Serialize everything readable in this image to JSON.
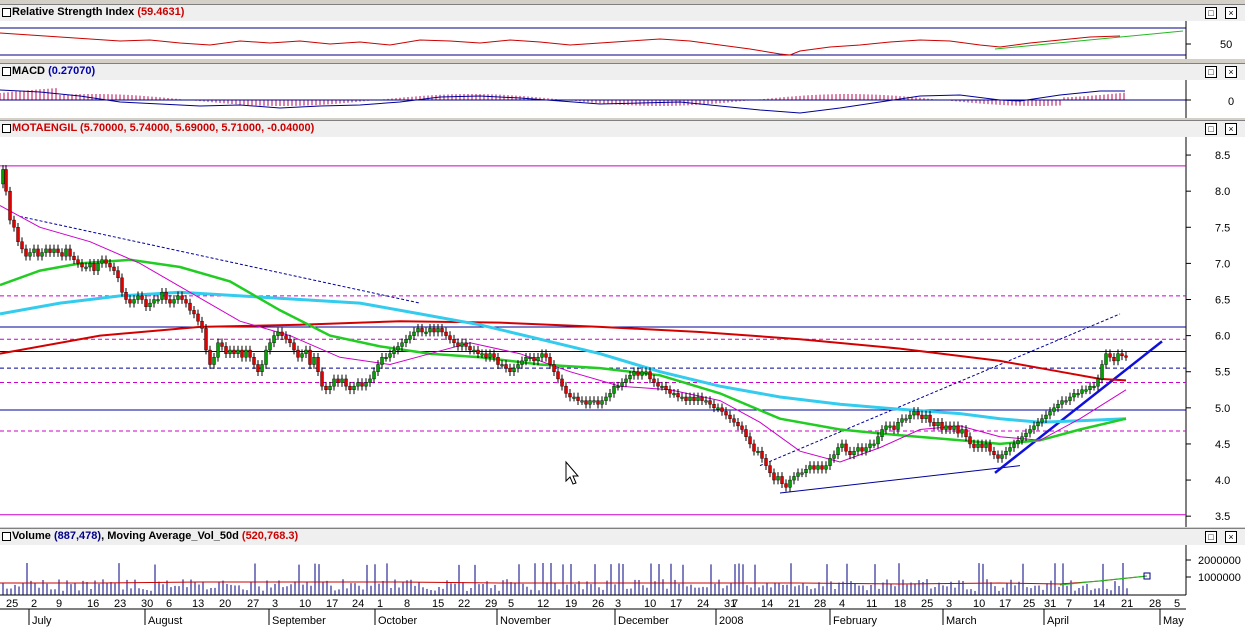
{
  "panels": {
    "rsi": {
      "name": "Relative Strength Index",
      "value": "(59.4631)",
      "tick": "50"
    },
    "macd": {
      "name": "MACD",
      "value": "(0.27070)",
      "tick": "0"
    },
    "price": {
      "name": "MOTAENGIL",
      "value": "(5.70000, 5.74000, 5.69000, 5.71000, -0.04000)"
    },
    "volume": {
      "name": "Volume",
      "value": "(887,478)",
      "ma_name": "Moving Average_Vol_50d",
      "ma_value": "(520,768.3)"
    }
  },
  "window_buttons": {
    "maximize": "□",
    "close": "×"
  },
  "colors": {
    "candle_up": "#00a000",
    "candle_down": "#e00000",
    "ma_red": "#d40000",
    "ma_cyan": "#33ccee",
    "ma_green": "#22cc22",
    "ma_magenta": "#cc00cc",
    "trend_blue": "#000099",
    "hline_magenta": "#cc00cc"
  },
  "chart_data": {
    "type": "candlestick",
    "symbol": "MOTAENGIL",
    "ylim": [
      3.35,
      8.75
    ],
    "y_ticks": [
      "8.5",
      "8.0",
      "7.5",
      "7.0",
      "6.5",
      "6.0",
      "5.5",
      "5.0",
      "4.5",
      "4.0",
      "3.5"
    ],
    "x_day_ticks": [
      "25",
      "2",
      "9",
      "16",
      "23",
      "30",
      "6",
      "13",
      "20",
      "27",
      "3",
      "10",
      "17",
      "24",
      "1",
      "8",
      "15",
      "22",
      "29",
      "5",
      "12",
      "19",
      "26",
      "3",
      "10",
      "17",
      "24",
      "31",
      "7",
      "14",
      "21",
      "28",
      "4",
      "11",
      "18",
      "25",
      "3",
      "10",
      "17",
      "25",
      "31",
      "7",
      "14",
      "21",
      "28",
      "5"
    ],
    "x_month_labels": [
      "July",
      "August",
      "September",
      "October",
      "November",
      "December",
      "2008",
      "February",
      "March",
      "April",
      "May"
    ],
    "close_path": [
      [
        0,
        8.1
      ],
      [
        3,
        8.3
      ],
      [
        6,
        8.0
      ],
      [
        10,
        7.6
      ],
      [
        14,
        7.5
      ],
      [
        18,
        7.3
      ],
      [
        22,
        7.2
      ],
      [
        26,
        7.1
      ],
      [
        30,
        7.15
      ],
      [
        34,
        7.2
      ],
      [
        38,
        7.1
      ],
      [
        42,
        7.15
      ],
      [
        46,
        7.2
      ],
      [
        50,
        7.15
      ],
      [
        54,
        7.2
      ],
      [
        58,
        7.15
      ],
      [
        62,
        7.1
      ],
      [
        66,
        7.2
      ],
      [
        70,
        7.1
      ],
      [
        74,
        7.05
      ],
      [
        78,
        7.0
      ],
      [
        82,
        6.95
      ],
      [
        86,
        6.95
      ],
      [
        90,
        7.0
      ],
      [
        94,
        6.9
      ],
      [
        98,
        7.0
      ],
      [
        102,
        7.05
      ],
      [
        106,
        7.0
      ],
      [
        110,
        6.95
      ],
      [
        114,
        6.9
      ],
      [
        118,
        6.8
      ],
      [
        122,
        6.6
      ],
      [
        126,
        6.5
      ],
      [
        130,
        6.45
      ],
      [
        134,
        6.5
      ],
      [
        138,
        6.55
      ],
      [
        142,
        6.5
      ],
      [
        146,
        6.4
      ],
      [
        150,
        6.45
      ],
      [
        154,
        6.5
      ],
      [
        158,
        6.5
      ],
      [
        162,
        6.6
      ],
      [
        166,
        6.5
      ],
      [
        170,
        6.45
      ],
      [
        174,
        6.5
      ],
      [
        178,
        6.55
      ],
      [
        182,
        6.5
      ],
      [
        186,
        6.45
      ],
      [
        190,
        6.35
      ],
      [
        194,
        6.3
      ],
      [
        198,
        6.2
      ],
      [
        202,
        6.1
      ],
      [
        206,
        5.8
      ],
      [
        210,
        5.6
      ],
      [
        214,
        5.7
      ],
      [
        218,
        5.9
      ],
      [
        222,
        5.85
      ],
      [
        226,
        5.75
      ],
      [
        230,
        5.8
      ],
      [
        234,
        5.75
      ],
      [
        238,
        5.8
      ],
      [
        242,
        5.7
      ],
      [
        246,
        5.8
      ],
      [
        250,
        5.7
      ],
      [
        254,
        5.6
      ],
      [
        258,
        5.5
      ],
      [
        262,
        5.6
      ],
      [
        266,
        5.8
      ],
      [
        270,
        5.9
      ],
      [
        274,
        6.0
      ],
      [
        278,
        6.05
      ],
      [
        282,
        6.0
      ],
      [
        286,
        5.95
      ],
      [
        290,
        5.9
      ],
      [
        294,
        5.8
      ],
      [
        298,
        5.7
      ],
      [
        302,
        5.75
      ],
      [
        306,
        5.8
      ],
      [
        310,
        5.6
      ],
      [
        314,
        5.7
      ],
      [
        318,
        5.5
      ],
      [
        322,
        5.3
      ],
      [
        326,
        5.25
      ],
      [
        330,
        5.3
      ],
      [
        334,
        5.4
      ],
      [
        338,
        5.35
      ],
      [
        342,
        5.4
      ],
      [
        346,
        5.3
      ],
      [
        350,
        5.25
      ],
      [
        354,
        5.3
      ],
      [
        358,
        5.35
      ],
      [
        362,
        5.3
      ],
      [
        366,
        5.35
      ],
      [
        370,
        5.4
      ],
      [
        374,
        5.5
      ],
      [
        378,
        5.6
      ],
      [
        382,
        5.7
      ],
      [
        386,
        5.7
      ],
      [
        390,
        5.75
      ],
      [
        394,
        5.8
      ],
      [
        398,
        5.85
      ],
      [
        402,
        5.9
      ],
      [
        406,
        5.95
      ],
      [
        410,
        6.0
      ],
      [
        414,
        6.05
      ],
      [
        418,
        6.1
      ],
      [
        422,
        6.05
      ],
      [
        426,
        6.05
      ],
      [
        430,
        6.1
      ],
      [
        434,
        6.05
      ],
      [
        438,
        6.1
      ],
      [
        442,
        6.05
      ],
      [
        446,
        6.0
      ],
      [
        450,
        5.95
      ],
      [
        454,
        5.9
      ],
      [
        458,
        5.85
      ],
      [
        462,
        5.9
      ],
      [
        466,
        5.85
      ],
      [
        470,
        5.8
      ],
      [
        474,
        5.8
      ],
      [
        478,
        5.75
      ],
      [
        482,
        5.75
      ],
      [
        486,
        5.7
      ],
      [
        490,
        5.75
      ],
      [
        494,
        5.7
      ],
      [
        498,
        5.6
      ],
      [
        502,
        5.6
      ],
      [
        506,
        5.55
      ],
      [
        510,
        5.5
      ],
      [
        514,
        5.55
      ],
      [
        518,
        5.6
      ],
      [
        522,
        5.65
      ],
      [
        526,
        5.7
      ],
      [
        530,
        5.7
      ],
      [
        534,
        5.65
      ],
      [
        538,
        5.7
      ],
      [
        542,
        5.75
      ],
      [
        546,
        5.7
      ],
      [
        550,
        5.6
      ],
      [
        554,
        5.5
      ],
      [
        558,
        5.4
      ],
      [
        562,
        5.3
      ],
      [
        566,
        5.2
      ],
      [
        570,
        5.15
      ],
      [
        574,
        5.15
      ],
      [
        578,
        5.1
      ],
      [
        582,
        5.1
      ],
      [
        586,
        5.05
      ],
      [
        590,
        5.1
      ],
      [
        594,
        5.1
      ],
      [
        598,
        5.05
      ],
      [
        602,
        5.1
      ],
      [
        606,
        5.15
      ],
      [
        610,
        5.2
      ],
      [
        614,
        5.3
      ],
      [
        618,
        5.3
      ],
      [
        622,
        5.35
      ],
      [
        626,
        5.4
      ],
      [
        630,
        5.45
      ],
      [
        634,
        5.5
      ],
      [
        638,
        5.45
      ],
      [
        642,
        5.5
      ],
      [
        646,
        5.5
      ],
      [
        650,
        5.4
      ],
      [
        654,
        5.35
      ],
      [
        658,
        5.3
      ],
      [
        662,
        5.3
      ],
      [
        666,
        5.25
      ],
      [
        670,
        5.2
      ],
      [
        674,
        5.2
      ],
      [
        678,
        5.15
      ],
      [
        682,
        5.15
      ],
      [
        686,
        5.1
      ],
      [
        690,
        5.15
      ],
      [
        694,
        5.1
      ],
      [
        698,
        5.15
      ],
      [
        702,
        5.1
      ],
      [
        706,
        5.1
      ],
      [
        710,
        5.05
      ],
      [
        714,
        5.0
      ],
      [
        718,
        5.0
      ],
      [
        722,
        4.95
      ],
      [
        726,
        4.9
      ],
      [
        730,
        4.85
      ],
      [
        734,
        4.8
      ],
      [
        738,
        4.75
      ],
      [
        742,
        4.7
      ],
      [
        746,
        4.6
      ],
      [
        750,
        4.5
      ],
      [
        754,
        4.4
      ],
      [
        758,
        4.4
      ],
      [
        762,
        4.3
      ],
      [
        766,
        4.2
      ],
      [
        770,
        4.1
      ],
      [
        774,
        4.0
      ],
      [
        778,
        4.05
      ],
      [
        782,
        3.95
      ],
      [
        786,
        3.9
      ],
      [
        790,
        4.0
      ],
      [
        794,
        4.05
      ],
      [
        798,
        4.1
      ],
      [
        802,
        4.1
      ],
      [
        806,
        4.15
      ],
      [
        810,
        4.2
      ],
      [
        814,
        4.15
      ],
      [
        818,
        4.2
      ],
      [
        822,
        4.15
      ],
      [
        826,
        4.2
      ],
      [
        830,
        4.3
      ],
      [
        834,
        4.35
      ],
      [
        838,
        4.45
      ],
      [
        842,
        4.5
      ],
      [
        846,
        4.4
      ],
      [
        850,
        4.35
      ],
      [
        854,
        4.4
      ],
      [
        858,
        4.45
      ],
      [
        862,
        4.4
      ],
      [
        866,
        4.45
      ],
      [
        870,
        4.5
      ],
      [
        874,
        4.5
      ],
      [
        878,
        4.6
      ],
      [
        882,
        4.7
      ],
      [
        886,
        4.75
      ],
      [
        890,
        4.75
      ],
      [
        894,
        4.7
      ],
      [
        898,
        4.8
      ],
      [
        902,
        4.85
      ],
      [
        906,
        4.85
      ],
      [
        910,
        4.9
      ],
      [
        914,
        4.95
      ],
      [
        918,
        4.9
      ],
      [
        922,
        4.85
      ],
      [
        926,
        4.9
      ],
      [
        930,
        4.8
      ],
      [
        934,
        4.75
      ],
      [
        938,
        4.8
      ],
      [
        942,
        4.7
      ],
      [
        946,
        4.75
      ],
      [
        950,
        4.7
      ],
      [
        954,
        4.75
      ],
      [
        958,
        4.65
      ],
      [
        962,
        4.7
      ],
      [
        966,
        4.6
      ],
      [
        970,
        4.5
      ],
      [
        974,
        4.45
      ],
      [
        978,
        4.5
      ],
      [
        982,
        4.45
      ],
      [
        986,
        4.5
      ],
      [
        990,
        4.4
      ],
      [
        994,
        4.35
      ],
      [
        998,
        4.3
      ],
      [
        1002,
        4.35
      ],
      [
        1006,
        4.4
      ],
      [
        1010,
        4.45
      ],
      [
        1014,
        4.5
      ],
      [
        1018,
        4.55
      ],
      [
        1022,
        4.6
      ],
      [
        1026,
        4.65
      ],
      [
        1030,
        4.7
      ],
      [
        1034,
        4.75
      ],
      [
        1038,
        4.8
      ],
      [
        1042,
        4.85
      ],
      [
        1046,
        4.9
      ],
      [
        1050,
        4.95
      ],
      [
        1054,
        5.0
      ],
      [
        1058,
        5.05
      ],
      [
        1062,
        5.1
      ],
      [
        1066,
        5.1
      ],
      [
        1070,
        5.15
      ],
      [
        1074,
        5.2
      ],
      [
        1078,
        5.2
      ],
      [
        1082,
        5.25
      ],
      [
        1086,
        5.25
      ],
      [
        1090,
        5.3
      ],
      [
        1094,
        5.3
      ],
      [
        1098,
        5.4
      ],
      [
        1102,
        5.6
      ],
      [
        1106,
        5.75
      ],
      [
        1110,
        5.7
      ],
      [
        1114,
        5.65
      ],
      [
        1118,
        5.75
      ],
      [
        1122,
        5.72
      ],
      [
        1126,
        5.71
      ]
    ],
    "ma_red": [
      [
        0,
        5.75
      ],
      [
        100,
        6.0
      ],
      [
        200,
        6.12
      ],
      [
        300,
        6.15
      ],
      [
        400,
        6.2
      ],
      [
        500,
        6.18
      ],
      [
        600,
        6.12
      ],
      [
        700,
        6.05
      ],
      [
        800,
        5.95
      ],
      [
        900,
        5.82
      ],
      [
        1000,
        5.65
      ],
      [
        1060,
        5.5
      ],
      [
        1100,
        5.4
      ],
      [
        1126,
        5.38
      ]
    ],
    "ma_cyan": [
      [
        0,
        6.3
      ],
      [
        60,
        6.45
      ],
      [
        120,
        6.55
      ],
      [
        180,
        6.6
      ],
      [
        240,
        6.55
      ],
      [
        300,
        6.5
      ],
      [
        360,
        6.45
      ],
      [
        420,
        6.3
      ],
      [
        480,
        6.15
      ],
      [
        540,
        5.95
      ],
      [
        600,
        5.75
      ],
      [
        660,
        5.5
      ],
      [
        720,
        5.3
      ],
      [
        780,
        5.15
      ],
      [
        840,
        5.05
      ],
      [
        900,
        4.98
      ],
      [
        960,
        4.92
      ],
      [
        1000,
        4.85
      ],
      [
        1040,
        4.8
      ],
      [
        1080,
        4.82
      ],
      [
        1126,
        4.85
      ]
    ],
    "ma_green": [
      [
        0,
        6.7
      ],
      [
        40,
        6.9
      ],
      [
        80,
        7.0
      ],
      [
        130,
        7.05
      ],
      [
        180,
        6.95
      ],
      [
        230,
        6.75
      ],
      [
        280,
        6.35
      ],
      [
        330,
        6.0
      ],
      [
        380,
        5.85
      ],
      [
        430,
        5.75
      ],
      [
        480,
        5.7
      ],
      [
        540,
        5.6
      ],
      [
        600,
        5.55
      ],
      [
        660,
        5.45
      ],
      [
        720,
        5.2
      ],
      [
        780,
        4.85
      ],
      [
        840,
        4.7
      ],
      [
        900,
        4.62
      ],
      [
        960,
        4.55
      ],
      [
        1000,
        4.5
      ],
      [
        1040,
        4.55
      ],
      [
        1080,
        4.7
      ],
      [
        1126,
        4.85
      ]
    ],
    "ma_magenta": [
      [
        0,
        7.8
      ],
      [
        40,
        7.5
      ],
      [
        90,
        7.3
      ],
      [
        140,
        7.0
      ],
      [
        190,
        6.6
      ],
      [
        240,
        6.2
      ],
      [
        290,
        6.0
      ],
      [
        340,
        5.7
      ],
      [
        390,
        5.6
      ],
      [
        430,
        5.75
      ],
      [
        470,
        5.9
      ],
      [
        520,
        5.75
      ],
      [
        570,
        5.5
      ],
      [
        620,
        5.3
      ],
      [
        670,
        5.25
      ],
      [
        720,
        5.1
      ],
      [
        760,
        4.8
      ],
      [
        800,
        4.4
      ],
      [
        840,
        4.25
      ],
      [
        880,
        4.45
      ],
      [
        920,
        4.7
      ],
      [
        960,
        4.75
      ],
      [
        1000,
        4.6
      ],
      [
        1040,
        4.55
      ],
      [
        1080,
        4.85
      ],
      [
        1126,
        5.25
      ]
    ],
    "horizontal_levels": [
      {
        "y": 8.35,
        "style": "solid",
        "color": "magenta"
      },
      {
        "y": 6.55,
        "style": "dashed",
        "color": "magenta"
      },
      {
        "y": 6.12,
        "style": "solid",
        "color": "navy"
      },
      {
        "y": 5.95,
        "style": "dashed",
        "color": "magenta"
      },
      {
        "y": 5.78,
        "style": "solid",
        "color": "navy"
      },
      {
        "y": 5.55,
        "style": "dashed",
        "color": "navy"
      },
      {
        "y": 5.35,
        "style": "dashed",
        "color": "magenta"
      },
      {
        "y": 4.97,
        "style": "solid",
        "color": "navy"
      },
      {
        "y": 4.68,
        "style": "dashed",
        "color": "magenta"
      },
      {
        "y": 3.52,
        "style": "solid",
        "color": "magenta"
      }
    ],
    "trendlines": [
      {
        "from": [
          20,
          7.65
        ],
        "to": [
          420,
          6.45
        ],
        "style": "dashed",
        "color": "navy"
      },
      {
        "from": [
          780,
          3.82
        ],
        "to": [
          1020,
          4.2
        ],
        "style": "solid",
        "color": "navy"
      },
      {
        "from": [
          760,
          4.2
        ],
        "to": [
          1120,
          6.3
        ],
        "style": "dashed",
        "color": "navy"
      },
      {
        "from": [
          995,
          4.1
        ],
        "to": [
          1162,
          5.92
        ],
        "style": "thick",
        "color": "blue"
      }
    ],
    "rsi": {
      "ylim": [
        0,
        100
      ],
      "level": 50,
      "value": 59.4631
    },
    "macd": {
      "value": 0.2707
    },
    "volume": {
      "ticks": [
        "2000000",
        "1000000"
      ],
      "last": 887478,
      "ma_50d": 520768.3
    }
  }
}
